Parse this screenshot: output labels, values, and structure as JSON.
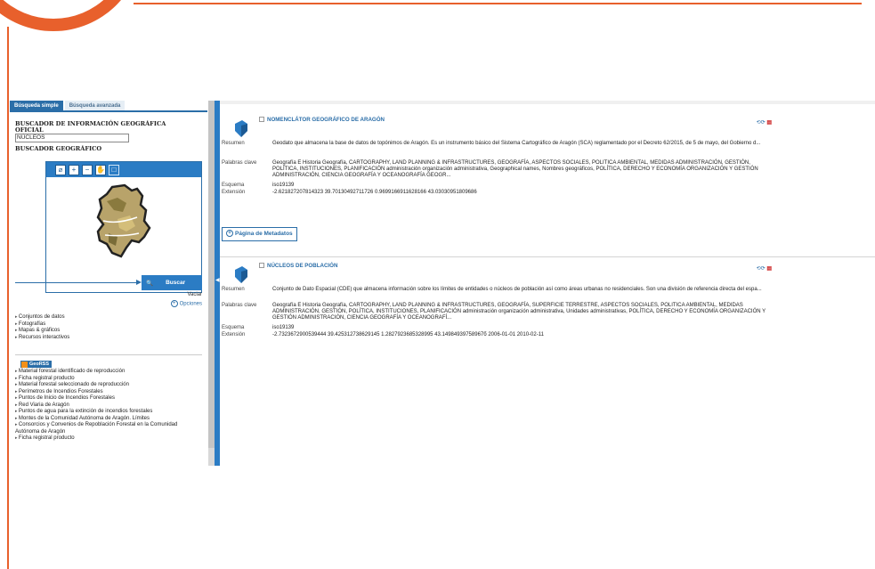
{
  "tabs": {
    "simple": "Búsqueda simple",
    "advanced": "Búsqueda avanzada"
  },
  "left": {
    "info_title_1": "BUSCADOR DE INFORMACIÓN GEOGRÁFICA",
    "info_title_2": "OFICIAL",
    "search_value": "NÚCLEOS",
    "geo_title": "BUSCADOR GEOGRÁFICO",
    "buscar": "Buscar",
    "vaciar": "Vaciar",
    "opciones": "Opciones",
    "categories": [
      "Conjuntos de datos",
      "Fotografías",
      "Mapas & gráficos",
      "Recursos interactivos"
    ],
    "georss": "GeoRSS",
    "rss_items": [
      "Material forestal identificado de reproducción",
      "Ficha registral producto",
      "Material forestal seleccionado de reproducción",
      "Perímetros de Incendios Forestales",
      "Puntos de Inicio de Incendios Forestales",
      "Red Viaria de Aragón",
      "Puntos de agua para la extinción de incendios forestales",
      "Montes de la Comunidad Autónoma de Aragón. Límites",
      "Consorcios y Convenios de Repoblación Forestal en la Comunidad Autónoma de Aragón",
      "Ficha registral producto"
    ]
  },
  "labels": {
    "resumen": "Resumen",
    "palabras": "Palabras clave",
    "esquema": "Esquema",
    "extension": "Extensión"
  },
  "results": [
    {
      "title": "NOMENCLÁTOR GEOGRÁFICO DE ARAGÓN",
      "resumen": "Geodato que almacena la base de datos de topónimos de Aragón. Es un instrumento básico del Sistema Cartográfico de Aragón (SCA) reglamentado por el Decreto 62/2015, de 5 de mayo, del Gobierno d...",
      "palabras": "Geografía E Historia Geografía, CARTOGRAPHY, LAND PLANNING & INFRASTRUCTURES, GEOGRAFÍA, ASPECTOS SOCIALES, POLITICA AMBIENTAL, MEDIDAS ADMINISTRACIÓN, GESTIÓN, POLÍTICA, INSTITUCIONES, PLANIFICACIÓN administración organización administrativa, Geographical names, Nombres geográficos, POLÍTICA, DERECHO Y ECONOMÍA ORGANIZACIÓN Y GESTIÓN ADMINISTRACIÓN, CIENCIA GEOGRAFÍA Y OCEANOGRAFÍA GEOGR...",
      "esquema": "iso19139",
      "extension": "-2.621827207814323 39.70130492711726 0.9699166911628166 43.03030951809686"
    },
    {
      "title": "NÚCLEOS DE POBLACIÓN",
      "resumen": "Conjunto de Dato Espacial (CDE) que almacena información sobre los límites de entidades o núcleos de población así como áreas urbanas no residenciales. Son una división de referencia directa del espa...",
      "palabras": "Geografía E Historia Geografía, CARTOGRAPHY, LAND PLANNING & INFRASTRUCTURES, GEOGRAFÍA, SUPERFICIE TERRESTRE, ASPECTOS SOCIALES, POLITICA AMBIENTAL, MEDIDAS ADMINISTRACIÓN, GESTIÓN, POLÍTICA, INSTITUCIONES, PLANIFICACIÓN administración organización administrativa, Unidades administrativas, POLÍTICA, DERECHO Y ECONOMÍA ORGANIZACIÓN Y GESTIÓN ADMINISTRACIÓN, CIENCIA GEOGRAFÍA Y OCEANOGRAFÍ...",
      "esquema": "iso19139",
      "extension": "-2.7323672900539444 39.425312738629145 1.2827923685328995 43.14984939758967б   2006-01-01 2010-02-11"
    }
  ],
  "metadata_button": "Página de Metadatos",
  "colors": {
    "accent": "#2b7cc4",
    "frame": "#e8602c"
  }
}
